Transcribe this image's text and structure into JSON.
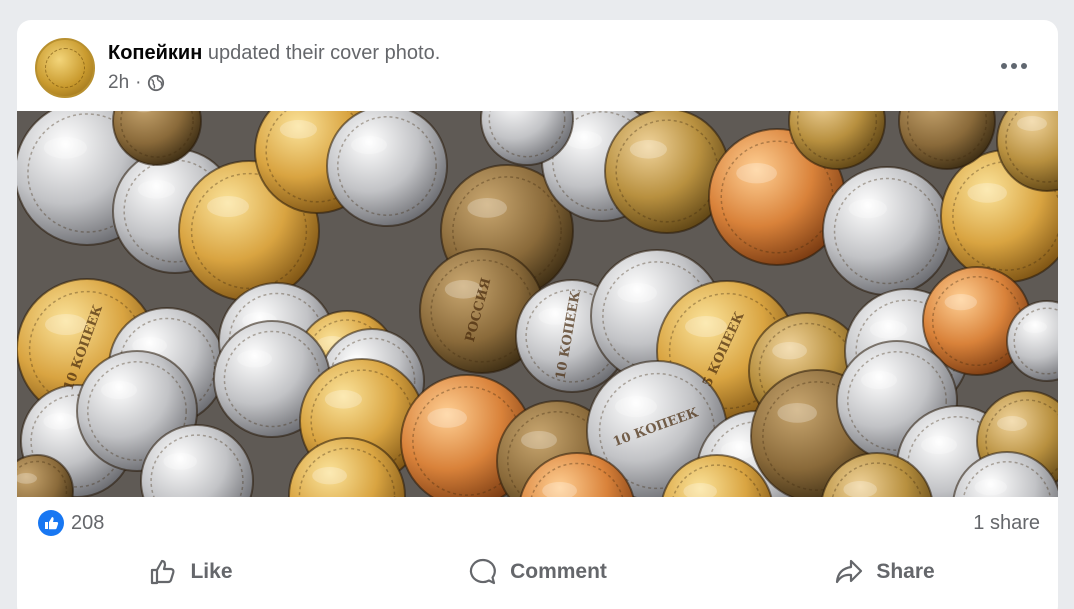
{
  "post": {
    "author": "Копейкин",
    "action_text": " updated their cover photo.",
    "time": "2h",
    "separator": "·",
    "audience_icon": "globe-icon",
    "more_icon": "more-horizontal-icon"
  },
  "image": {
    "coins": [
      {
        "label": "10 КОПЕЕК",
        "color": "#d9a441"
      },
      {
        "label": "РОССИЯ",
        "color": "#c9c9c9"
      },
      {
        "label": "5 КОПЕЕК",
        "color": "#b0b0ae"
      },
      {
        "label": "10 КОПЕЕК",
        "color": "#e08e3c"
      }
    ]
  },
  "stats": {
    "reaction_icon": "like-reaction-icon",
    "likes": "208",
    "shares": "1 share"
  },
  "actions": [
    {
      "label": "Like",
      "icon": "thumbs-up-icon"
    },
    {
      "label": "Comment",
      "icon": "comment-bubble-icon"
    },
    {
      "label": "Share",
      "icon": "share-arrow-icon"
    }
  ],
  "colors": {
    "accent": "#1877f2",
    "text_secondary": "#65676b",
    "text_primary": "#050505"
  }
}
